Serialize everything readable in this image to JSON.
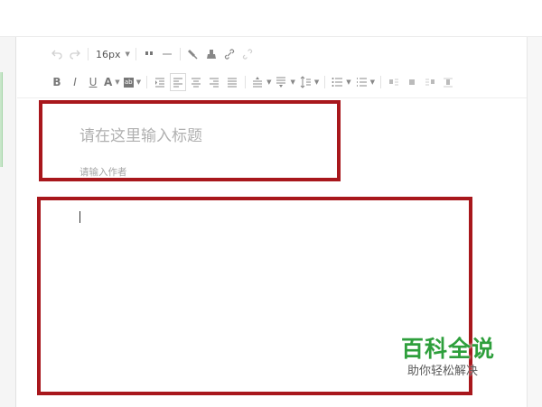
{
  "toolbar": {
    "font_size_value": "16px",
    "row1_icons": [
      "undo-icon",
      "redo-icon",
      "quote-icon",
      "horizontal-rule-icon",
      "format-painter-icon",
      "clear-format-icon",
      "link-icon",
      "unlink-icon"
    ],
    "row2_icons": [
      "bold-icon",
      "italic-icon",
      "underline-icon",
      "font-color-icon",
      "highlight-icon",
      "indent-icon",
      "align-left-icon",
      "align-center-icon",
      "align-right-icon",
      "justify-icon",
      "paragraph-spacing-before-icon",
      "paragraph-spacing-after-icon",
      "line-height-icon",
      "unordered-list-icon",
      "ordered-list-icon",
      "image-left-icon",
      "image-none-icon",
      "image-right-icon",
      "image-center-icon"
    ],
    "bold_label": "B",
    "italic_label": "I",
    "underline_label": "U",
    "font_color_label": "A",
    "highlight_label": "ab"
  },
  "editor": {
    "title_placeholder": "请在这里输入标题",
    "author_placeholder": "请输入作者"
  },
  "watermark": {
    "brand": "百科全说",
    "slogan": "助你轻松解决"
  },
  "colors": {
    "annotation_red": "#a8171c",
    "brand_green": "#2e9f3c"
  }
}
